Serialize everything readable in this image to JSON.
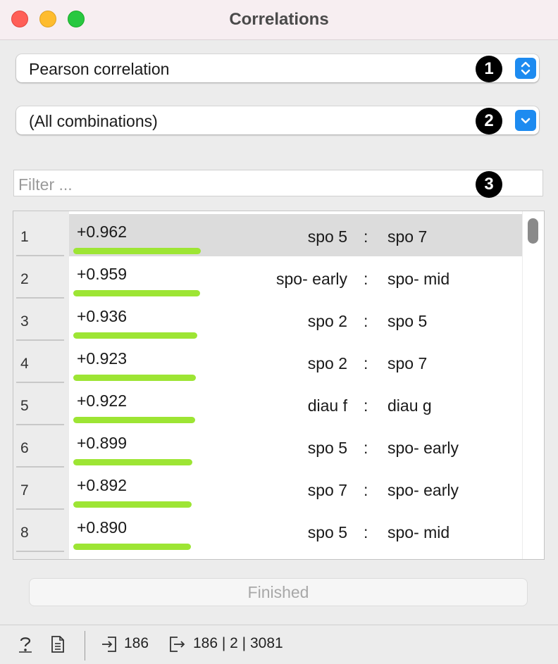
{
  "window": {
    "title": "Correlations"
  },
  "method_select": {
    "value": "Pearson correlation",
    "marker": "1"
  },
  "feature_select": {
    "value": "(All combinations)",
    "marker": "2"
  },
  "filter": {
    "placeholder": "Filter ...",
    "value": "",
    "marker": "3"
  },
  "table": {
    "rows": [
      {
        "index": "1",
        "value": "+0.962",
        "bar_fraction": 0.962,
        "attr1": "spo 5",
        "sep": ":",
        "attr2": "spo 7",
        "selected": true
      },
      {
        "index": "2",
        "value": "+0.959",
        "bar_fraction": 0.959,
        "attr1": "spo- early",
        "sep": ":",
        "attr2": "spo- mid",
        "selected": false
      },
      {
        "index": "3",
        "value": "+0.936",
        "bar_fraction": 0.936,
        "attr1": "spo 2",
        "sep": ":",
        "attr2": "spo 5",
        "selected": false
      },
      {
        "index": "4",
        "value": "+0.923",
        "bar_fraction": 0.923,
        "attr1": "spo 2",
        "sep": ":",
        "attr2": "spo 7",
        "selected": false
      },
      {
        "index": "5",
        "value": "+0.922",
        "bar_fraction": 0.922,
        "attr1": "diau f",
        "sep": ":",
        "attr2": "diau g",
        "selected": false
      },
      {
        "index": "6",
        "value": "+0.899",
        "bar_fraction": 0.899,
        "attr1": "spo 5",
        "sep": ":",
        "attr2": "spo- early",
        "selected": false
      },
      {
        "index": "7",
        "value": "+0.892",
        "bar_fraction": 0.892,
        "attr1": "spo 7",
        "sep": ":",
        "attr2": "spo- early",
        "selected": false
      },
      {
        "index": "8",
        "value": "+0.890",
        "bar_fraction": 0.89,
        "attr1": "spo 5",
        "sep": ":",
        "attr2": "spo- mid",
        "selected": false
      }
    ]
  },
  "finish_button": {
    "label": "Finished"
  },
  "status": {
    "input_count": "186",
    "output_summary": "186 | 2 | 3081"
  },
  "colors": {
    "bar": "#9de534",
    "accent": "#1d8bf0",
    "selected_row": "#dcdcdc"
  }
}
